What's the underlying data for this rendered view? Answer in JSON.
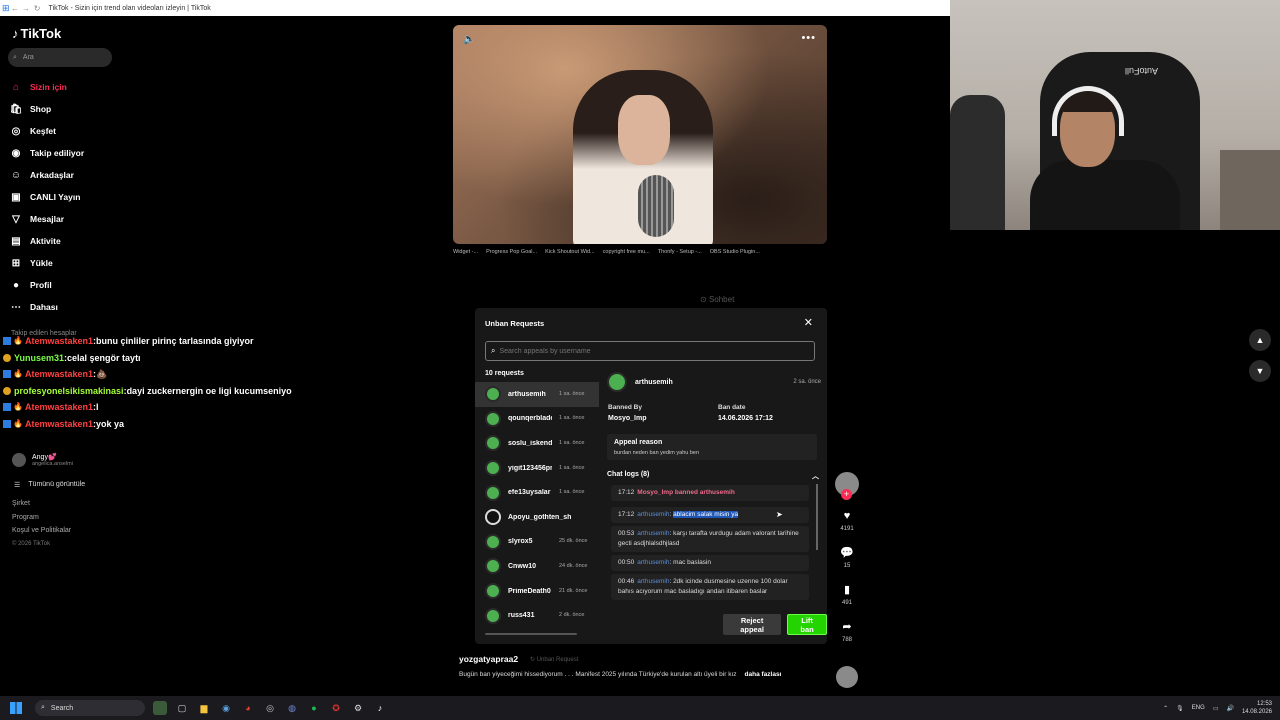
{
  "browser": {
    "tab_title": "TikTok - Sizin için trend olan videoları izleyin | TikTok"
  },
  "tiktok": {
    "logo": "TikTok",
    "search_placeholder": "Ara",
    "nav": [
      {
        "label": "Sizin için",
        "icon": "home-icon",
        "active": true
      },
      {
        "label": "Shop",
        "icon": "shop-icon"
      },
      {
        "label": "Keşfet",
        "icon": "compass-icon"
      },
      {
        "label": "Takip ediliyor",
        "icon": "following-icon"
      },
      {
        "label": "Arkadaşlar",
        "icon": "friends-icon"
      },
      {
        "label": "CANLI Yayın",
        "icon": "live-icon"
      },
      {
        "label": "Mesajlar",
        "icon": "messages-icon"
      },
      {
        "label": "Aktivite",
        "icon": "activity-icon"
      },
      {
        "label": "Yükle",
        "icon": "upload-icon"
      },
      {
        "label": "Profil",
        "icon": "profile-icon"
      },
      {
        "label": "Dahası",
        "icon": "more-icon"
      }
    ],
    "followed_title": "Takip edilen hesaplar",
    "followed": [
      {
        "name": "Angy💕",
        "handle": "angelica.anselmi"
      }
    ],
    "show_all": "Tümünü görüntüle",
    "footer": [
      "Şirket",
      "Program",
      "Koşul ve Politikalar",
      "© 2026 TikTok"
    ]
  },
  "chat_overlay": [
    {
      "user": "Atemwastaken1",
      "user_color": "red",
      "msg": "bunu çinliler pirinç tarlasında giyiyor"
    },
    {
      "user": "Yunusem31",
      "user_color": "green",
      "msg": "celal şengör taytı"
    },
    {
      "user": "Atemwastaken1",
      "user_color": "red",
      "msg": "💩"
    },
    {
      "user": "profesyonelsikismakinasi",
      "user_color": "lime",
      "msg": "dayi zuckernergin oe ligi kucumseniyo"
    },
    {
      "user": "Atemwastaken1",
      "user_color": "red",
      "msg": "l"
    },
    {
      "user": "Atemwastaken1",
      "user_color": "red",
      "msg": "yok ya"
    }
  ],
  "bookmarks": [
    "Widget -...",
    "Progress Pop Goal...",
    "Kick Shoutout Wid...",
    "copyright free mu...",
    "Thonfy - Setup -...",
    "OBS Studio Plugin..."
  ],
  "sohbet": "Sohbet",
  "unban_modal": {
    "title": "Unban Requests",
    "search_placeholder": "Search appeals by username",
    "count": "10 requests",
    "requests": [
      {
        "name": "arthusemih",
        "time": "1 sa. önce",
        "selected": true
      },
      {
        "name": "qounqerblade",
        "time": "1 sa. önce"
      },
      {
        "name": "soslu_iskender",
        "time": "1 sa. önce"
      },
      {
        "name": "yigit123456propro",
        "time": "1 sa. önce"
      },
      {
        "name": "efe13uysalar",
        "time": "1 sa. önce"
      },
      {
        "name": "Apoyu_gothten_shiken_cha",
        "time": "",
        "black": true
      },
      {
        "name": "slyrox5",
        "time": "25 dk. önce"
      },
      {
        "name": "Cnww10",
        "time": "24 dk. önce"
      },
      {
        "name": "PrimeDeath0",
        "time": "21 dk. önce"
      },
      {
        "name": "russ431",
        "time": "2 dk. önce"
      }
    ],
    "detail": {
      "user": "arthusemih",
      "time": "2 sa. önce",
      "banned_by_label": "Banned By",
      "banned_by": "Mosyo_Imp",
      "ban_date_label": "Ban date",
      "ban_date": "14.06.2026 17:12",
      "appeal_reason_label": "Appeal reason",
      "appeal_reason": "burdan neden ban yedim yahu ben",
      "chat_logs_label": "Chat logs (8)",
      "logs": [
        {
          "time": "17:12",
          "user": "Mosyo_Imp banned arthusemih",
          "msg": "",
          "type": "ban"
        },
        {
          "time": "17:12",
          "user": "arthusemih",
          "msg": "ablacim salak misin ya",
          "type": "highlight"
        },
        {
          "time": "00:53",
          "user": "arthusemih",
          "msg": "karşı tarafta vurdugu adam valorant tarihine gecti asdjhlalsdhjlasd",
          "type": "normal"
        },
        {
          "time": "00:50",
          "user": "arthusemih",
          "msg": "mac baslasin",
          "type": "normal"
        },
        {
          "time": "00:46",
          "user": "arthusemih",
          "msg": "2dk icinde dusmesine uzenne 100 dolar bahıs acıyorum mac basladıgı andan itibaren baslar",
          "type": "normal"
        }
      ]
    },
    "reject_label": "Reject appeal",
    "lift_label": "Lift ban"
  },
  "caption": {
    "user": "yozgatyapraa2",
    "bg_label": "Unban Request",
    "text": "Bugün ban yiyeceğimi hissediyorum . . . Manifest 2025 yılında Türkiye'de kurulan altı üyeli bir kız",
    "more": "daha fazlası"
  },
  "rail": {
    "likes": "4191",
    "comments": "15",
    "saves": "491",
    "shares": "788"
  },
  "taskbar": {
    "search": "Search",
    "lang": "ENG",
    "time": "12:53",
    "date": "14.08.2026"
  },
  "webcam": {
    "chair_brand": "AutoFull"
  }
}
